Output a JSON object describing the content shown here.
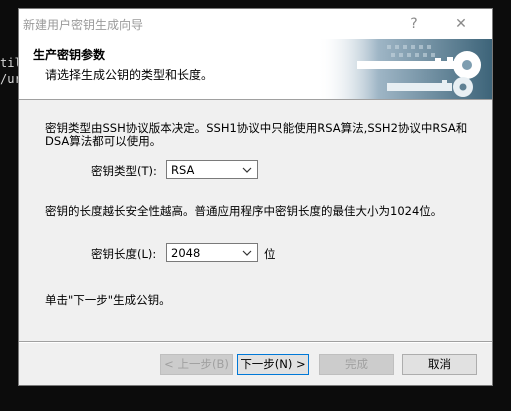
{
  "terminal": {
    "line1": "til",
    "line2": "/ur"
  },
  "dialog": {
    "title": "新建用户密钥生成向导",
    "help_label": "?",
    "close_label": "✕"
  },
  "header": {
    "title": "生产密钥参数",
    "subtitle": "请选择生成公钥的类型和长度。"
  },
  "content": {
    "desc_line1": "密钥类型由SSH协议版本决定。SSH1协议中只能使用RSA算法,SSH2协议中RSA和",
    "desc_line2": "DSA算法都可以使用。",
    "key_type_label": "密钥类型(T):",
    "key_type_value": "RSA",
    "length_desc": "密钥的长度越长安全性越高。普通应用程序中密钥长度的最佳大小为1024位。",
    "key_length_label": "密钥长度(L):",
    "key_length_value": "2048",
    "key_length_unit": "位",
    "instruction": "单击\"下一步\"生成公钥。"
  },
  "buttons": {
    "back": "< 上一步(B)",
    "next": "下一步(N) >",
    "finish": "完成",
    "cancel": "取消"
  }
}
